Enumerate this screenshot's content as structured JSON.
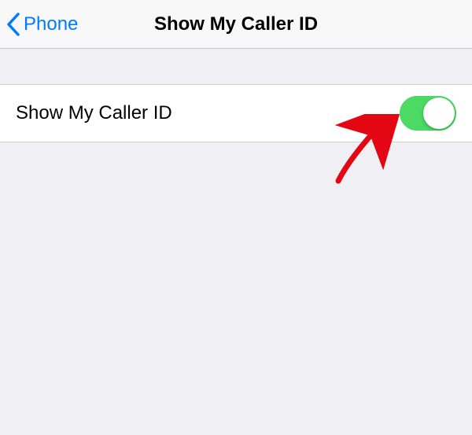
{
  "navbar": {
    "back_label": "Phone",
    "title": "Show My Caller ID"
  },
  "settings": {
    "caller_id": {
      "label": "Show My Caller ID",
      "enabled": true
    }
  },
  "colors": {
    "accent": "#007aff",
    "toggle_on": "#4cd964",
    "background": "#efeff4",
    "annotation": "#e30613"
  }
}
